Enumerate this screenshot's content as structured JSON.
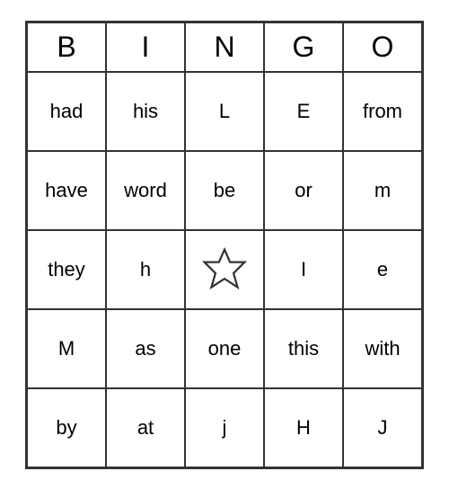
{
  "header": {
    "letters": [
      "B",
      "I",
      "N",
      "G",
      "O"
    ]
  },
  "grid": [
    [
      "had",
      "his",
      "L",
      "E",
      "from"
    ],
    [
      "have",
      "word",
      "be",
      "or",
      "m"
    ],
    [
      "they",
      "h",
      "★",
      "I",
      "e"
    ],
    [
      "M",
      "as",
      "one",
      "this",
      "with"
    ],
    [
      "by",
      "at",
      "j",
      "H",
      "J"
    ]
  ]
}
